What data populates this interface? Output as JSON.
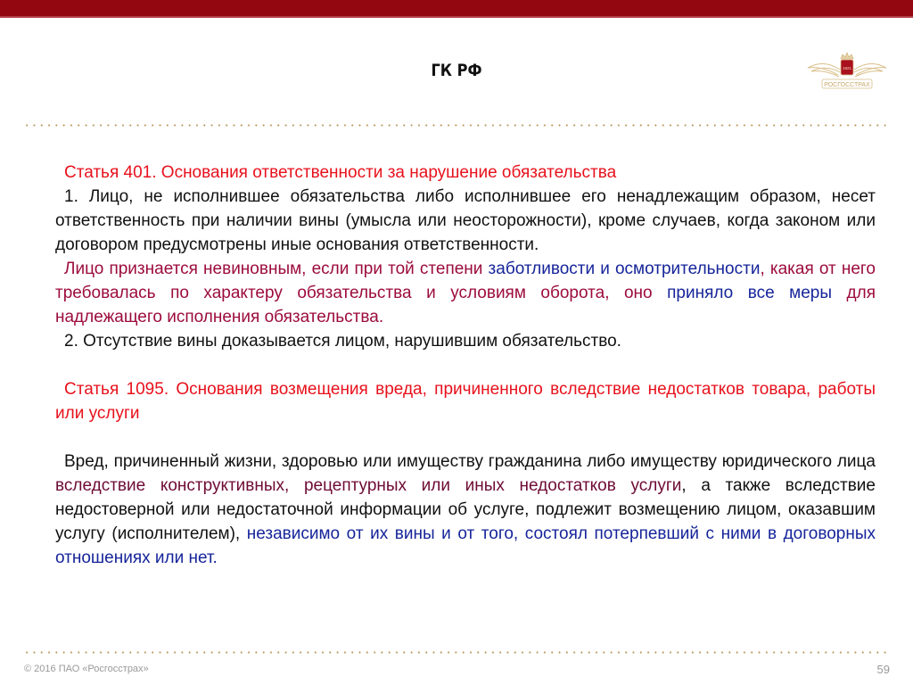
{
  "header": {
    "title": "ГК РФ",
    "logo_text": "РОСГОССТРАХ",
    "logo_year": "1921"
  },
  "colors": {
    "topbar": "#930711",
    "heading_red": "#e8111c",
    "emphasis_crimson": "#9c0c3c",
    "emphasis_blue": "#16259a",
    "emphasis_maroon": "#6e0b34",
    "dots_gold": "#b8955a"
  },
  "article401": {
    "heading": "Статья 401. Основания ответственности за нарушение обязательства",
    "para1": "1. Лицо, не исполнившее обязательства либо исполнившее его ненадлежащим образом, несет ответственность при наличии вины (умысла или неосторожности), кроме случаев, когда законом или договором предусмотрены иные основания ответственности.",
    "para2_seg1": "Лицо признается невиновным, если при той степени ",
    "para2_seg2": "заботливости и осмотрительности",
    "para2_seg3": ", какая от него требовалась по характеру обязательства и условиям оборота, оно ",
    "para2_seg4": "приняло все меры",
    "para2_seg5": " для надлежащего исполнения обязательства.",
    "para3": "2. Отсутствие вины доказывается лицом, нарушившим обязательство."
  },
  "article1095": {
    "heading": "Статья 1095. Основания возмещения вреда, причиненного вследствие недостатков товара, работы или услуги",
    "para_seg1": "Вред, причиненный жизни, здоровью или имуществу гражданина либо имуществу юридического лица ",
    "para_seg2": "вследствие конструктивных, рецептурных или иных недостатков услуги",
    "para_seg3": ", а также вследствие недостоверной или недостаточной информации об услуге, подлежит возмещению лицом, оказавшим услугу (исполнителем), ",
    "para_seg4": "независимо от их вины и от того, состоял потерпевший с ними в договорных отношениях или нет."
  },
  "footer": {
    "copyright": "© 2016 ПАО «Росгосстрах»",
    "page_number": "59"
  }
}
